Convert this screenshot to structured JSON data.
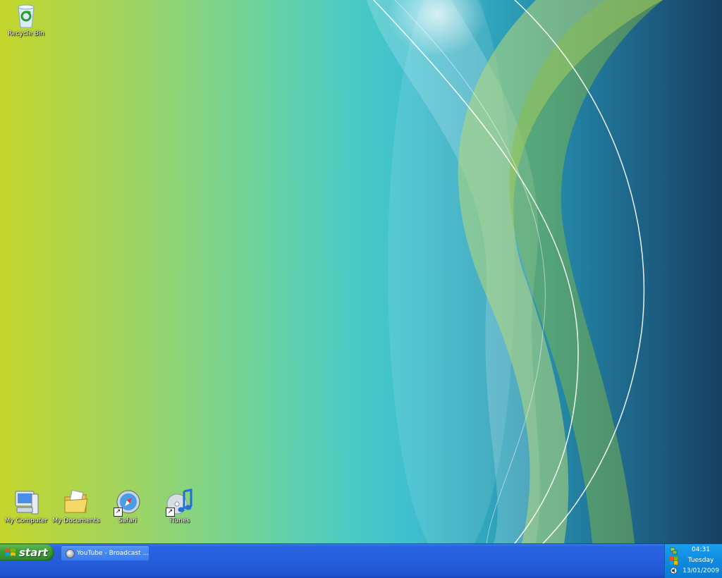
{
  "desktop": {
    "icons": [
      {
        "label": "Recycle Bin",
        "icon": "recycle-bin-icon"
      },
      {
        "label": "My Computer",
        "icon": "my-computer-icon"
      },
      {
        "label": "My Documents",
        "icon": "my-documents-icon"
      },
      {
        "label": "Safari",
        "icon": "safari-icon",
        "shortcut": true
      },
      {
        "label": "iTunes",
        "icon": "itunes-icon",
        "shortcut": true
      }
    ]
  },
  "taskbar": {
    "start_label": "start",
    "tasks": [
      {
        "label": "YouTube - Broadcast ...",
        "icon": "browser-globe-icon"
      }
    ],
    "tray": {
      "time": "04:31",
      "day": "Tuesday",
      "date": "13/01/2009",
      "icons": [
        "network-icon",
        "windows-flag-icon",
        "speaker-icon"
      ]
    }
  },
  "colors": {
    "taskbar_blue": "#245edc",
    "start_green": "#3c9e35",
    "tray_blue": "#0f8ae0"
  }
}
